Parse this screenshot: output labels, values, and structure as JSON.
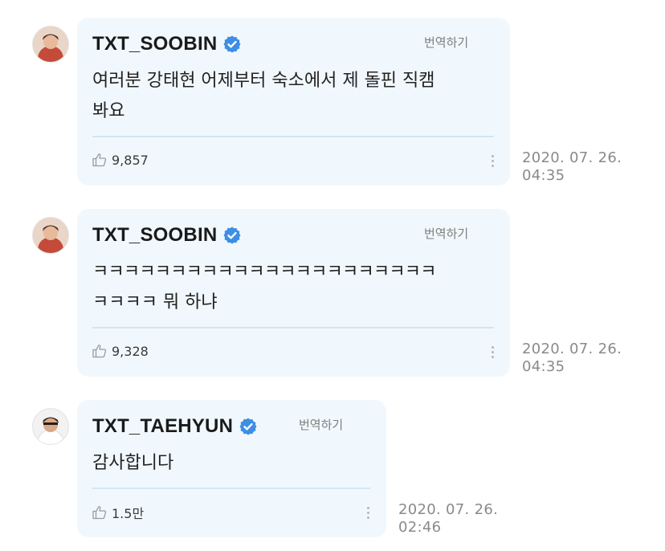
{
  "comments": [
    {
      "username": "TXT_SOOBIN",
      "verified": true,
      "translate_label": "번역하기",
      "text_lines": [
        "여러분 강태현 어제부터 숙소에서 제 돌핀 직캠",
        "봐요"
      ],
      "likes": "9,857",
      "date": "2020. 07. 26.",
      "time": "04:35"
    },
    {
      "username": "TXT_SOOBIN",
      "verified": true,
      "translate_label": "번역하기",
      "text_lines": [
        "ㅋㅋㅋㅋㅋㅋㅋㅋㅋㅋㅋㅋㅋㅋㅋㅋㅋㅋㅋㅋㅋㅋ",
        "ㅋㅋㅋㅋ 뭐 하냐"
      ],
      "likes": "9,328",
      "date": "2020. 07. 26.",
      "time": "04:35"
    },
    {
      "username": "TXT_TAEHYUN",
      "verified": true,
      "translate_label": "번역하기",
      "text_lines": [
        "감사합니다"
      ],
      "likes": "1.5만",
      "date": "2020. 07. 26.",
      "time": "02:46"
    }
  ],
  "colors": {
    "bubble": "#f1f8fd",
    "divider": "#cfe7f6",
    "verified_badge": "#3d8ee6"
  }
}
